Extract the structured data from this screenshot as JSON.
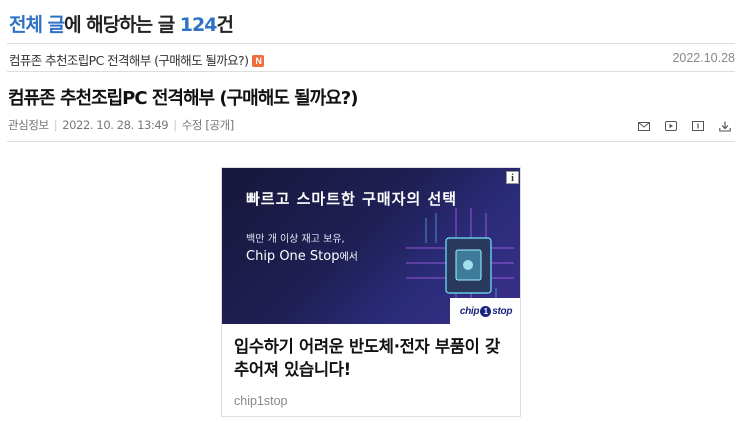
{
  "header": {
    "part1": "전체 글",
    "part2": "에 해당하는 글 ",
    "count": "124",
    "part3": "건"
  },
  "list": {
    "title": "컴퓨존 추천조립PC 전격해부 (구매해도 될까요?)",
    "badge": "N",
    "date": "2022.10.28"
  },
  "post": {
    "title": "컴퓨존 추천조립PC 전격해부 (구매해도 될까요?)",
    "category": "관심정보",
    "datetime": "2022. 10. 28. 13:49",
    "edit": "수정",
    "visibility": "[공개]"
  },
  "tools": [
    "mail-icon",
    "play-icon",
    "card-icon",
    "download-icon"
  ],
  "ad": {
    "headline": "빠르고 스마트한 구매자의 선택",
    "sub1": "백만 개 이상 재고 보유,",
    "sub2_main": "Chip One Stop",
    "sub2_suffix": "에서",
    "logo_left": "chip",
    "logo_num": "1",
    "logo_right": "stop",
    "info": "i",
    "copy": "입수하기 어려운 반도체·전자 부품이 갖추어져 있습니다!",
    "source": "chip1stop"
  },
  "colors": {
    "accent": "#2f72c4",
    "badge": "#f26b3a",
    "ad_bg": "#1f1f55",
    "divider": "#dddddd"
  }
}
